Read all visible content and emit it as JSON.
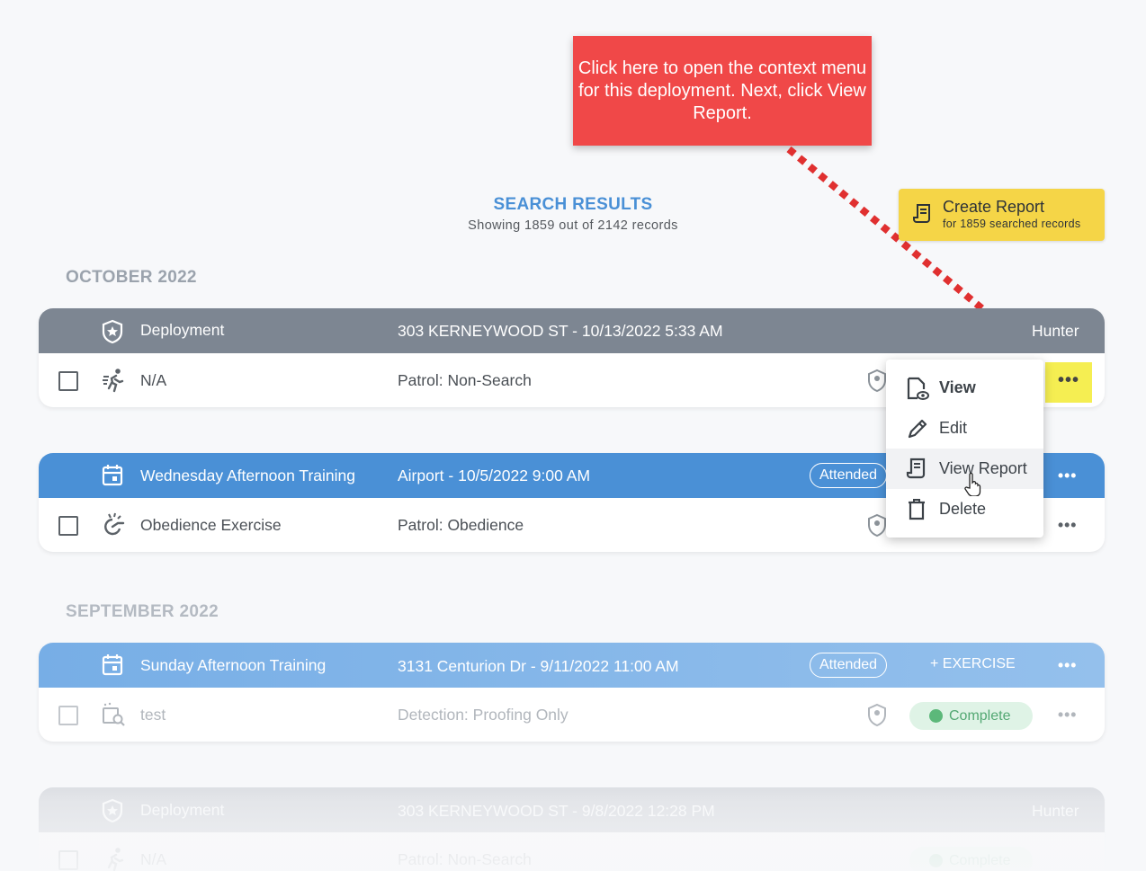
{
  "callout": {
    "text": "Click here to open the context menu for this deployment. Next, click View Report."
  },
  "results": {
    "title": "SEARCH RESULTS",
    "subtitle": "Showing 1859 out of 2142 records"
  },
  "create_report": {
    "title": "Create Report",
    "subtitle": "for 1859 searched records"
  },
  "months": [
    "OCTOBER 2022",
    "SEPTEMBER 2022"
  ],
  "cards": [
    {
      "type": "Deployment",
      "location_time": "303 KERNEYWOOD ST - 10/13/2022 5:33 AM",
      "handler": "Hunter",
      "row": {
        "name": "N/A",
        "category": "Patrol: Non-Search"
      }
    },
    {
      "type": "Wednesday Afternoon Training",
      "location_time": "Airport - 10/5/2022 9:00 AM",
      "status": "Attended",
      "row": {
        "name": "Obedience Exercise",
        "category": "Patrol: Obedience"
      }
    },
    {
      "type": "Sunday Afternoon Training",
      "location_time": "3131 Centurion Dr - 9/11/2022 11:00 AM",
      "status": "Attended",
      "action": "+ EXERCISE",
      "row": {
        "name": "test",
        "category": "Detection: Proofing Only",
        "state": "Complete"
      }
    },
    {
      "type": "Deployment",
      "location_time": "303 KERNEYWOOD ST - 9/8/2022 12:28 PM",
      "handler": "Hunter",
      "row": {
        "name": "N/A",
        "category": "Patrol: Non-Search",
        "state": "Complete"
      }
    }
  ],
  "more_label": "•••",
  "context_menu": {
    "items": [
      "View",
      "Edit",
      "View Report",
      "Delete"
    ]
  },
  "colors": {
    "accent": "#4a90d6",
    "callout": "#f04848",
    "highlight": "#f5ee52",
    "create_button": "#f5d547",
    "deployment_header": "#7d8692"
  }
}
